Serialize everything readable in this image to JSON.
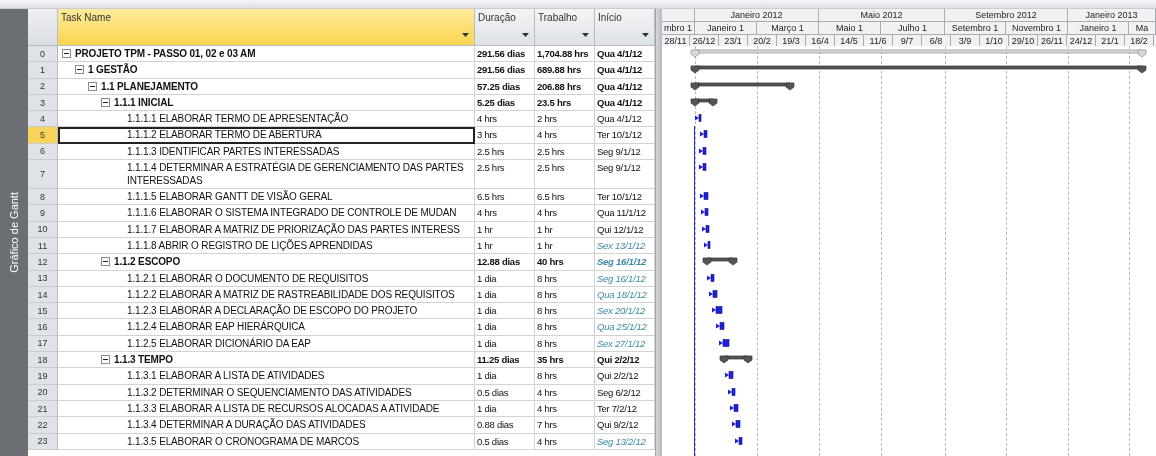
{
  "sidebar": {
    "label": "Gráfico de Gantt"
  },
  "columns": [
    {
      "label": "Task Name",
      "selected": true
    },
    {
      "label": "Duração",
      "selected": false
    },
    {
      "label": "Trabalho",
      "selected": false
    },
    {
      "label": "Início",
      "selected": false
    }
  ],
  "timescale": {
    "tiers": [
      {
        "labels": [
          "Janeiro 2012",
          "Maio 2012",
          "Setembro 2012",
          "Janeiro 2013"
        ]
      },
      {
        "labels": [
          "mbro 1",
          "Janeiro 1",
          "Março 1",
          "Maio 1",
          "Julho 1",
          "Setembro 1",
          "Novembro 1",
          "Janeiro 1",
          "Ma"
        ]
      },
      {
        "labels": [
          "28/11",
          "26/12",
          "23/1",
          "20/2",
          "19/3",
          "16/4",
          "14/5",
          "11/6",
          "9/7",
          "6/8",
          "3/9",
          "1/10",
          "29/10",
          "26/11",
          "24/12",
          "21/1",
          "18/2"
        ]
      }
    ]
  },
  "tasks": [
    {
      "id": "0",
      "kind": "project",
      "name": "PROJETO TPM - PASSO 01, 02 e 03 AM",
      "duration": "291.56 dias",
      "work": "1,704.88 hrs",
      "start": "Qua 4/1/12",
      "start_highlighted": false,
      "selected": false,
      "expanded": true,
      "children": [
        {
          "id": "1",
          "kind": "summary",
          "name": "1 GESTÃO",
          "duration": "291.56 dias",
          "work": "689.88 hrs",
          "start": "Qua 4/1/12",
          "start_highlighted": false,
          "selected": false,
          "expanded": true,
          "children": [
            {
              "id": "2",
              "kind": "summary",
              "name": "1.1 PLANEJAMENTO",
              "duration": "57.25 dias",
              "work": "206.88 hrs",
              "start": "Qua 4/1/12",
              "start_highlighted": false,
              "selected": false,
              "expanded": true,
              "children": [
                {
                  "id": "3",
                  "kind": "summary",
                  "name": "1.1.1 INICIAL",
                  "duration": "5.25 dias",
                  "work": "23.5 hrs",
                  "start": "Qua 4/1/12",
                  "start_highlighted": false,
                  "selected": false,
                  "expanded": true,
                  "children": [
                    {
                      "id": "4",
                      "kind": "task",
                      "name": "1.1.1.1 ELABORAR TERMO DE APRESENTAÇÃO",
                      "duration": "4 hrs",
                      "work": "2 hrs",
                      "start": "Qua 4/1/12",
                      "start_highlighted": false,
                      "selected": false
                    },
                    {
                      "id": "5",
                      "kind": "task",
                      "name": "1.1.1.2 ELABORAR TERMO DE ABERTURA",
                      "duration": "3 hrs",
                      "work": "4 hrs",
                      "start": "Ter 10/1/12",
                      "start_highlighted": false,
                      "selected": true
                    },
                    {
                      "id": "6",
                      "kind": "task",
                      "name": "1.1.1.3 IDENTIFICAR PARTES INTERESSADAS",
                      "duration": "2.5 hrs",
                      "work": "2.5 hrs",
                      "start": "Seg 9/1/12",
                      "start_highlighted": false,
                      "selected": false
                    },
                    {
                      "id": "7",
                      "kind": "task",
                      "name": "1.1.1.4 DETERMINAR A ESTRATÉGIA DE GERENCIAMENTO DAS PARTES INTERESSADAS",
                      "duration": "2.5 hrs",
                      "work": "2.5 hrs",
                      "start": "Seg 9/1/12",
                      "start_highlighted": false,
                      "selected": false
                    },
                    {
                      "id": "8",
                      "kind": "task",
                      "name": "1.1.1.5 ELABORAR GANTT DE VISÃO GERAL",
                      "duration": "6.5 hrs",
                      "work": "6.5 hrs",
                      "start": "Ter 10/1/12",
                      "start_highlighted": false,
                      "selected": false
                    },
                    {
                      "id": "9",
                      "kind": "task",
                      "name": "1.1.1.6 ELABORAR O SISTEMA INTEGRADO DE CONTROLE DE MUDAN",
                      "duration": "4 hrs",
                      "work": "4 hrs",
                      "start": "Qua 11/1/12",
                      "start_highlighted": false,
                      "selected": false
                    },
                    {
                      "id": "10",
                      "kind": "task",
                      "name": "1.1.1.7 ELABORAR A MATRIZ DE PRIORIZAÇÃO DAS PARTES INTERESS",
                      "duration": "1 hr",
                      "work": "1 hr",
                      "start": "Qui 12/1/12",
                      "start_highlighted": false,
                      "selected": false
                    },
                    {
                      "id": "11",
                      "kind": "task",
                      "name": "1.1.1.8 ABRIR O REGISTRO DE LIÇÕES APRENDIDAS",
                      "duration": "1 hr",
                      "work": "1 hr",
                      "start": "Sex 13/1/12",
                      "start_highlighted": true,
                      "selected": false
                    }
                  ]
                },
                {
                  "id": "12",
                  "kind": "summary",
                  "name": "1.1.2 ESCOPO",
                  "duration": "12.88 dias",
                  "work": "40 hrs",
                  "start": "Seg 16/1/12",
                  "start_highlighted": true,
                  "selected": false,
                  "expanded": true,
                  "children": [
                    {
                      "id": "13",
                      "kind": "task",
                      "name": "1.1.2.1 ELABORAR O DOCUMENTO DE REQUISITOS",
                      "duration": "1 dia",
                      "work": "8 hrs",
                      "start": "Seg 16/1/12",
                      "start_highlighted": true,
                      "selected": false
                    },
                    {
                      "id": "14",
                      "kind": "task",
                      "name": "1.1.2.2 ELABORAR A MATRIZ DE RASTREABILIDADE DOS REQUISITOS",
                      "duration": "1 dia",
                      "work": "8 hrs",
                      "start": "Qua 18/1/12",
                      "start_highlighted": true,
                      "selected": false
                    },
                    {
                      "id": "15",
                      "kind": "task",
                      "name": "1.1.2.3 ELABORAR A DECLARAÇÃO DE ESCOPO DO PROJETO",
                      "duration": "1 dia",
                      "work": "8 hrs",
                      "start": "Sex 20/1/12",
                      "start_highlighted": true,
                      "selected": false
                    },
                    {
                      "id": "16",
                      "kind": "task",
                      "name": "1.1.2.4 ELABORAR EAP HIERÁRQUICA",
                      "duration": "1 dia",
                      "work": "8 hrs",
                      "start": "Qua 25/1/12",
                      "start_highlighted": true,
                      "selected": false
                    },
                    {
                      "id": "17",
                      "kind": "task",
                      "name": "1.1.2.5 ELABORAR DICIONÁRIO DA EAP",
                      "duration": "1 dia",
                      "work": "8 hrs",
                      "start": "Sex 27/1/12",
                      "start_highlighted": true,
                      "selected": false
                    }
                  ]
                },
                {
                  "id": "18",
                  "kind": "summary",
                  "name": "1.1.3 TEMPO",
                  "duration": "11.25 dias",
                  "work": "35 hrs",
                  "start": "Qui 2/2/12",
                  "start_highlighted": false,
                  "selected": false,
                  "expanded": true,
                  "children": [
                    {
                      "id": "19",
                      "kind": "task",
                      "name": "1.1.3.1 ELABORAR A LISTA DE ATIVIDADES",
                      "duration": "1 dia",
                      "work": "8 hrs",
                      "start": "Qui 2/2/12",
                      "start_highlighted": false,
                      "selected": false
                    },
                    {
                      "id": "20",
                      "kind": "task",
                      "name": "1.1.3.2 DETERMINAR O SEQUENCIAMENTO DAS ATIVIDADES",
                      "duration": "0.5 dias",
                      "work": "4 hrs",
                      "start": "Seg 6/2/12",
                      "start_highlighted": false,
                      "selected": false
                    },
                    {
                      "id": "21",
                      "kind": "task",
                      "name": "1.1.3.3 ELABORAR A LISTA DE RECURSOS ALOCADAS A ATIVIDADE",
                      "duration": "1 dia",
                      "work": "4 hrs",
                      "start": "Ter 7/2/12",
                      "start_highlighted": false,
                      "selected": false
                    },
                    {
                      "id": "22",
                      "kind": "task",
                      "name": "1.1.3.4 DETERMINAR A DURAÇÃO DAS ATIVIDADES",
                      "duration": "0.88 dias",
                      "work": "7 hrs",
                      "start": "Qui 9/2/12",
                      "start_highlighted": false,
                      "selected": false
                    },
                    {
                      "id": "23",
                      "kind": "task",
                      "name": "1.1.3.5 ELABORAR O CRONOGRAMA DE MARCOS",
                      "duration": "0.5 dias",
                      "work": "4 hrs",
                      "start": "Seg 13/2/12",
                      "start_highlighted": true,
                      "selected": false
                    }
                  ]
                }
              ]
            }
          ]
        }
      ]
    }
  ]
}
